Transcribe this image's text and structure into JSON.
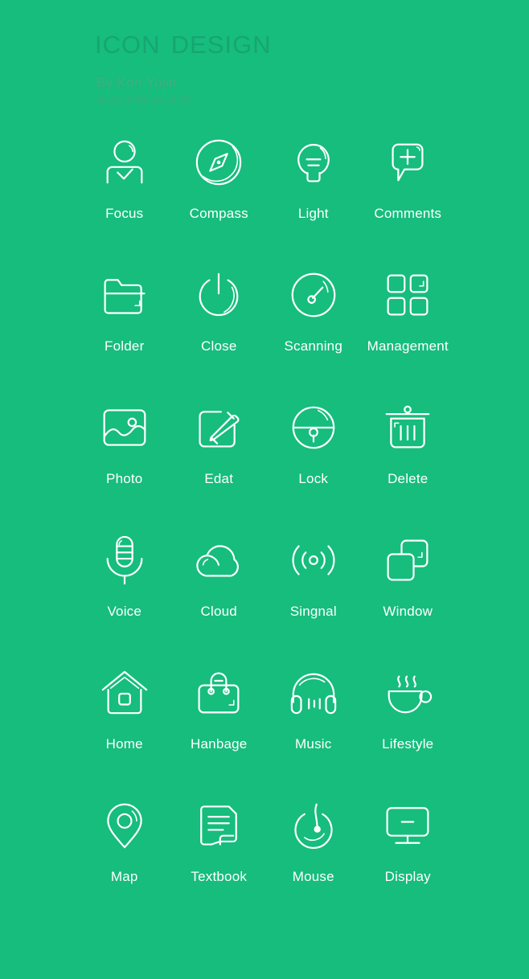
{
  "header": {
    "title": "Icon Design",
    "byline": "By Kon Yujin",
    "timestamp": "At 2015-03-10 18:28"
  },
  "colors": {
    "background": "#16bd7d",
    "title_text": "#17a571",
    "byline_text": "#3fae84",
    "icon_stroke": "#ffffff",
    "caption_text": "#ffffff"
  },
  "grid": {
    "columns": 4,
    "rows": 6,
    "items": [
      {
        "label": "Focus",
        "icon": "person-check-icon"
      },
      {
        "label": "Compass",
        "icon": "compass-icon"
      },
      {
        "label": "Light",
        "icon": "lightbulb-icon"
      },
      {
        "label": "Comments",
        "icon": "speech-bubble-plus-icon"
      },
      {
        "label": "Folder",
        "icon": "folder-icon"
      },
      {
        "label": "Close",
        "icon": "power-icon"
      },
      {
        "label": "Scanning",
        "icon": "gauge-icon"
      },
      {
        "label": "Management",
        "icon": "grid-squares-icon"
      },
      {
        "label": "Photo",
        "icon": "image-icon"
      },
      {
        "label": "Edat",
        "icon": "pencil-edit-icon"
      },
      {
        "label": "Lock",
        "icon": "padlock-icon"
      },
      {
        "label": "Delete",
        "icon": "trash-can-icon"
      },
      {
        "label": "Voice",
        "icon": "microphone-icon"
      },
      {
        "label": "Cloud",
        "icon": "cloud-icon"
      },
      {
        "label": "Singnal",
        "icon": "wireless-signal-icon"
      },
      {
        "label": "Window",
        "icon": "overlapping-windows-icon"
      },
      {
        "label": "Home",
        "icon": "house-icon"
      },
      {
        "label": "Hanbage",
        "icon": "handbag-icon"
      },
      {
        "label": "Music",
        "icon": "headphones-icon"
      },
      {
        "label": "Lifestyle",
        "icon": "coffee-cup-icon"
      },
      {
        "label": "Map",
        "icon": "location-pin-icon"
      },
      {
        "label": "Textbook",
        "icon": "document-lines-icon"
      },
      {
        "label": "Mouse",
        "icon": "mouse-disc-icon"
      },
      {
        "label": "Display",
        "icon": "monitor-icon"
      }
    ]
  }
}
